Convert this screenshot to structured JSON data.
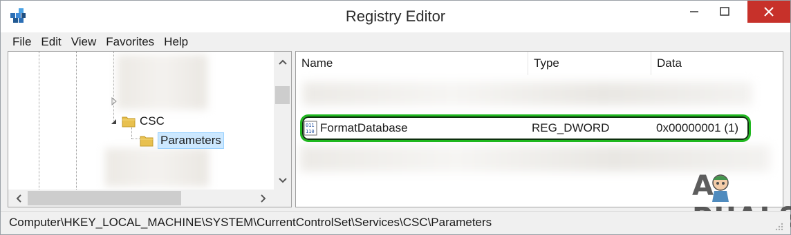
{
  "window": {
    "title": "Registry Editor",
    "minimize_glyph": "–",
    "maximize_glyph": "□",
    "close_glyph": "✕"
  },
  "menu": {
    "items": [
      "File",
      "Edit",
      "View",
      "Favorites",
      "Help"
    ]
  },
  "tree": {
    "nodes": [
      {
        "label": "CSC",
        "expanded": true,
        "icon": "folder-icon"
      },
      {
        "label": "Parameters",
        "selected": true,
        "icon": "folder-icon"
      }
    ]
  },
  "values": {
    "columns": [
      "Name",
      "Type",
      "Data"
    ],
    "highlighted_row": {
      "name": "FormatDatabase",
      "type": "REG_DWORD",
      "data": "0x00000001 (1)",
      "icon": "reg-dword-icon"
    }
  },
  "status": {
    "path": "Computer\\HKEY_LOCAL_MACHINE\\SYSTEM\\CurrentControlSet\\Services\\CSC\\Parameters"
  },
  "watermark": {
    "text": "A  PUALS"
  },
  "colors": {
    "highlight_border": "#1fb81f",
    "selection_bg": "#cce8ff",
    "close_button": "#c7312a"
  }
}
